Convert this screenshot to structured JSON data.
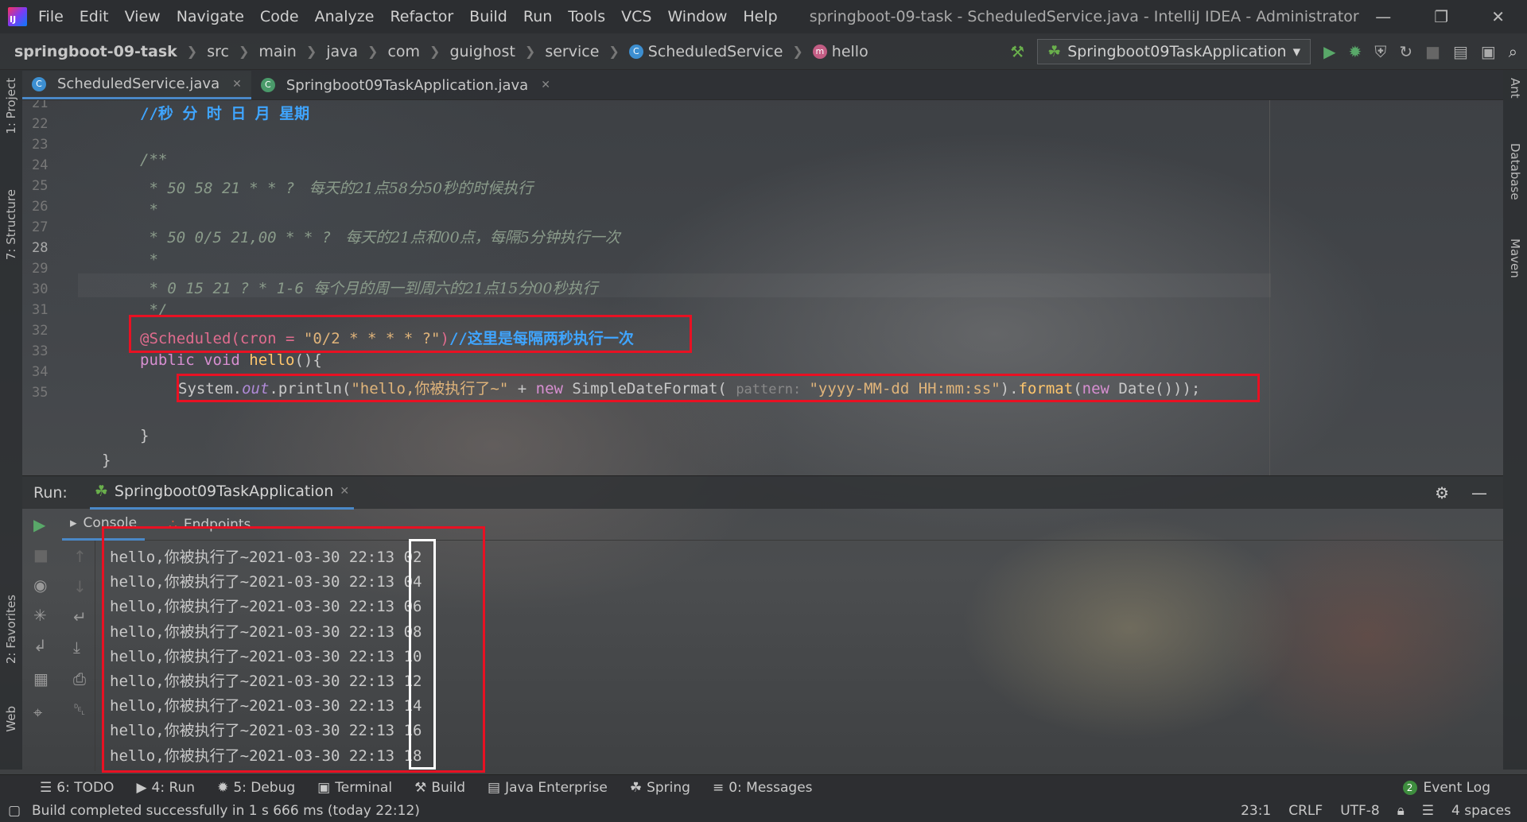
{
  "menu": {
    "items": [
      "File",
      "Edit",
      "View",
      "Navigate",
      "Code",
      "Analyze",
      "Refactor",
      "Build",
      "Run",
      "Tools",
      "VCS",
      "Window",
      "Help"
    ],
    "window_title": "springboot-09-task - ScheduledService.java - IntelliJ IDEA - Administrator"
  },
  "nav": {
    "crumbs": [
      "springboot-09-task",
      "src",
      "main",
      "java",
      "com",
      "guighost",
      "service",
      "ScheduledService",
      "hello"
    ],
    "run_config": "Springboot09TaskApplication"
  },
  "tabs": [
    {
      "label": "ScheduledService.java"
    },
    {
      "label": "Springboot09TaskApplication.java"
    }
  ],
  "left_strip": {
    "project": "1: Project",
    "structure": "7: Structure",
    "favorites": "2: Favorites",
    "web": "Web"
  },
  "right_strip": {
    "ant": "Ant",
    "database": "Database",
    "maven": "Maven"
  },
  "editor": {
    "line_numbers": [
      "21",
      "22",
      "23",
      "24",
      "25",
      "26",
      "27",
      "28",
      "29",
      "30",
      "31",
      "32",
      "33",
      "34",
      "35"
    ],
    "l21": "//秒 分 时 日 月 星期",
    "l23": "/**",
    "l24a": " * 50 58 21 * * ?",
    "l24b": "   每天的21点58分50秒的时候执行",
    "l25": " *",
    "l26a": " * 50 0/5 21,00 * * ?",
    "l26b": "   每天的21点和00点，每隔5分钟执行一次",
    "l27": " *",
    "l28a": " * 0 15 21 ? * 1-6",
    "l28b": "  每个月的周一到周六的21点15分00秒执行",
    "l29": " */",
    "l30a": "@Scheduled(cron = ",
    "l30b": "\"0/2 * * * * ?\"",
    "l30c": ")",
    "l30d": "//这里是每隔两秒执行一次",
    "l31a": "public void ",
    "l31b": "hello",
    "l31c": "(){",
    "l32a": "System.",
    "l32b": "out",
    "l32c": ".println(",
    "l32d": "\"hello,你被执行了~\"",
    "l32e": " + ",
    "l32f": "new ",
    "l32g": "SimpleDateFormat( ",
    "l32h": "pattern: ",
    "l32i": "\"yyyy-MM-dd HH:mm:ss\"",
    "l32j": ").",
    "l32k": "format",
    "l32l": "(",
    "l32m": "new ",
    "l32n": "Date()));",
    "l34": "}",
    "l35": "}"
  },
  "run": {
    "label": "Run:",
    "tab": "Springboot09TaskApplication",
    "console_tab": "Console",
    "endpoints_tab": "Endpoints",
    "output_prefix": "hello,你被执行了~2021-03-30 22:13",
    "seconds": [
      "02",
      "04",
      "06",
      "08",
      "10",
      "12",
      "14",
      "16",
      "18"
    ]
  },
  "bottom_bar": {
    "items": [
      "6: TODO",
      "4: Run",
      "5: Debug",
      "Terminal",
      "Build",
      "Java Enterprise",
      "Spring",
      "0: Messages"
    ],
    "event_badge": "2",
    "event_log": "Event Log"
  },
  "status": {
    "message": "Build completed successfully in 1 s 666 ms (today 22:12)",
    "position": "23:1",
    "line_sep": "CRLF",
    "encoding": "UTF-8",
    "indent": "4 spaces"
  },
  "colors": {
    "highlight_box": "#e81123",
    "seconds_box": "#ffffff",
    "accent": "#4a88c7"
  }
}
